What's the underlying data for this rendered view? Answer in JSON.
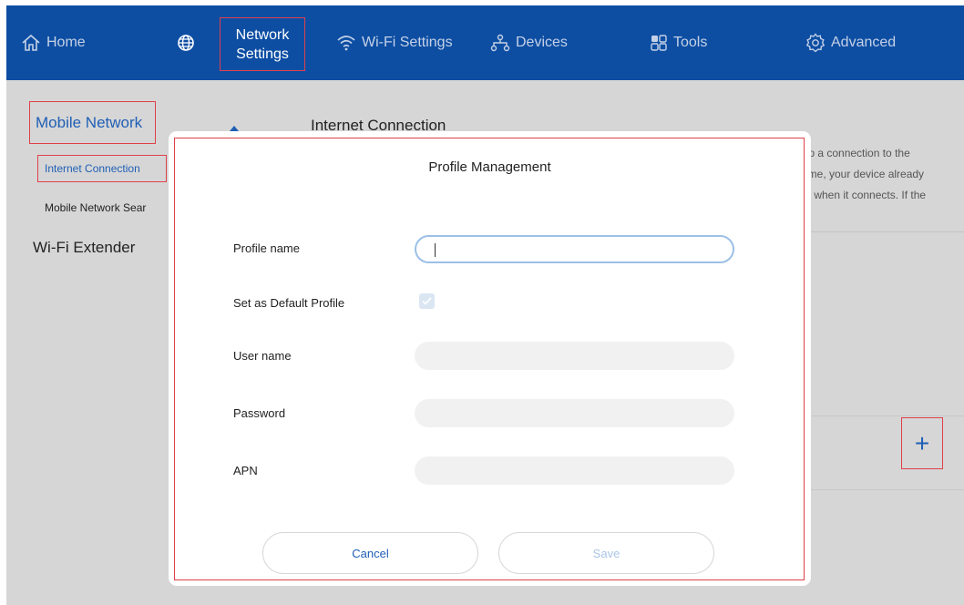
{
  "nav": {
    "home": "Home",
    "network_settings_line1": "Network",
    "network_settings_line2": "Settings",
    "wifi_settings": "Wi-Fi Settings",
    "devices": "Devices",
    "tools": "Tools",
    "advanced": "Advanced"
  },
  "sidebar": {
    "mobile_network": "Mobile Network",
    "internet_connection": "Internet Connection",
    "mobile_network_search": "Mobile Network Sear",
    "wifi_extender": "Wi-Fi Extender"
  },
  "content": {
    "heading": "Internet Connection",
    "description_line1": "ıp a connection to the",
    "description_line2": "ime, your device already",
    "description_line3": "y when it connects. If the"
  },
  "add_button": "+",
  "modal": {
    "title": "Profile Management",
    "profile_name_label": "Profile name",
    "profile_name_value": "",
    "default_profile_label": "Set as Default Profile",
    "default_profile_checked": true,
    "user_name_label": "User name",
    "user_name_value": "",
    "password_label": "Password",
    "password_value": "",
    "apn_label": "APN",
    "apn_value": "",
    "cancel_label": "Cancel",
    "save_label": "Save"
  },
  "colors": {
    "nav_bg": "#0d4ea3",
    "accent": "#1f5fb6",
    "highlight_border": "#e0404a",
    "overlay_bg": "#d6d6d6",
    "save_disabled": "#a9c4e6"
  }
}
